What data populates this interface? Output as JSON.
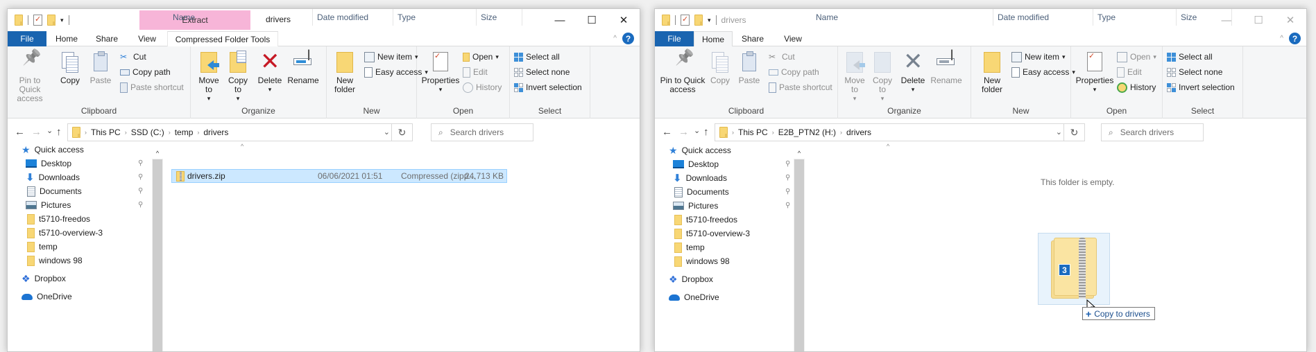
{
  "left_window": {
    "title": "drivers",
    "context_tab_header": "Extract",
    "tabs": [
      "File",
      "Home",
      "Share",
      "View",
      "Compressed Folder Tools"
    ],
    "window_controls": {
      "minimize": "—",
      "maximize": "☐",
      "close": "✕"
    },
    "ribbon": {
      "clipboard": {
        "label": "Clipboard",
        "pin": "Pin to Quick access",
        "copy": "Copy",
        "paste": "Paste",
        "cut": "Cut",
        "copy_path": "Copy path",
        "paste_shortcut": "Paste shortcut"
      },
      "organize": {
        "label": "Organize",
        "move_to": "Move to",
        "copy_to": "Copy to",
        "delete": "Delete",
        "rename": "Rename"
      },
      "new": {
        "label": "New",
        "new_folder": "New folder",
        "new_item": "New item",
        "easy_access": "Easy access"
      },
      "open": {
        "label": "Open",
        "properties": "Properties",
        "open": "Open",
        "edit": "Edit",
        "history": "History"
      },
      "select": {
        "label": "Select",
        "select_all": "Select all",
        "select_none": "Select none",
        "invert": "Invert selection"
      }
    },
    "breadcrumb": [
      "This PC",
      "SSD (C:)",
      "temp",
      "drivers"
    ],
    "search_placeholder": "Search drivers",
    "columns": [
      "Name",
      "Date modified",
      "Type",
      "Size"
    ],
    "files": [
      {
        "name": "drivers.zip",
        "date": "06/06/2021 01:51",
        "type": "Compressed (zipp...",
        "size": "24,713 KB",
        "selected": true
      }
    ]
  },
  "right_window": {
    "title": "drivers",
    "tabs": [
      "File",
      "Home",
      "Share",
      "View"
    ],
    "window_controls": {
      "minimize": "—",
      "maximize": "☐",
      "close": "✕"
    },
    "ribbon": {
      "clipboard": {
        "label": "Clipboard",
        "pin": "Pin to Quick access",
        "copy": "Copy",
        "paste": "Paste",
        "cut": "Cut",
        "copy_path": "Copy path",
        "paste_shortcut": "Paste shortcut"
      },
      "organize": {
        "label": "Organize",
        "move_to": "Move to",
        "copy_to": "Copy to",
        "delete": "Delete",
        "rename": "Rename"
      },
      "new": {
        "label": "New",
        "new_folder": "New folder",
        "new_item": "New item",
        "easy_access": "Easy access"
      },
      "open": {
        "label": "Open",
        "properties": "Properties",
        "open": "Open",
        "edit": "Edit",
        "history": "History"
      },
      "select": {
        "label": "Select",
        "select_all": "Select all",
        "select_none": "Select none",
        "invert": "Invert selection"
      }
    },
    "breadcrumb": [
      "This PC",
      "E2B_PTN2 (H:)",
      "drivers"
    ],
    "search_placeholder": "Search drivers",
    "columns": [
      "Name",
      "Date modified",
      "Type",
      "Size"
    ],
    "empty_message": "This folder is empty."
  },
  "nav_pane": {
    "quick_access": "Quick access",
    "items": [
      {
        "label": "Desktop",
        "icon": "desktop-icon",
        "pinned": true
      },
      {
        "label": "Downloads",
        "icon": "downloads-icon",
        "pinned": true
      },
      {
        "label": "Documents",
        "icon": "documents-icon",
        "pinned": true
      },
      {
        "label": "Pictures",
        "icon": "pictures-icon",
        "pinned": true
      },
      {
        "label": "t5710-freedos",
        "icon": "folder-icon",
        "pinned": false
      },
      {
        "label": "t5710-overview-3",
        "icon": "folder-icon",
        "pinned": false
      },
      {
        "label": "temp",
        "icon": "folder-icon",
        "pinned": false
      },
      {
        "label": "windows 98",
        "icon": "folder-icon",
        "pinned": false
      }
    ],
    "dropbox": "Dropbox",
    "onedrive": "OneDrive"
  },
  "drag": {
    "count": "3",
    "tooltip": "Copy to drivers",
    "tooltip_symbol": "+"
  },
  "glyphs": {
    "back": "←",
    "forward": "→",
    "recent": "⌄",
    "up": "↑",
    "chev_sep": "›",
    "dropdown": "⌄",
    "refresh": "↻",
    "search": "⌕",
    "sort_up": "^",
    "scroll_up": "^",
    "pin": "📌",
    "help": "?",
    "collapse": "^",
    "caret": "▾",
    "star": "★",
    "download": "⬇",
    "dropbox": "❖"
  }
}
